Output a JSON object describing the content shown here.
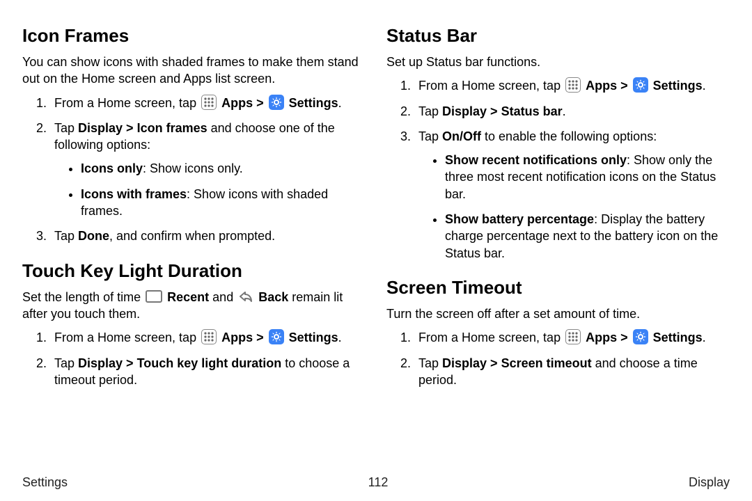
{
  "footer": {
    "left": "Settings",
    "page": "112",
    "right": "Display"
  },
  "common": {
    "home_prefix": "From a Home screen, tap ",
    "apps": "Apps",
    "settings": "Settings",
    "chev": " > ",
    "period": "."
  },
  "icon_frames": {
    "heading": "Icon Frames",
    "lead": "You can show icons with shaded frames to make them stand out on the Home screen and Apps list screen.",
    "step2a": "Tap ",
    "step2b": "Display > Icon frames",
    "step2c": " and choose one of the following options:",
    "opt1a": "Icons only",
    "opt1b": ": Show icons only.",
    "opt2a": "Icons with frames",
    "opt2b": ": Show icons with shaded frames.",
    "step3a": "Tap ",
    "step3b": "Done",
    "step3c": ", and confirm when prompted."
  },
  "touch_key": {
    "heading": "Touch Key Light Duration",
    "lead1": "Set the length of time ",
    "recent": "Recent",
    "and": " and ",
    "back": "Back",
    "lead2": " remain lit after you touch them.",
    "step2a": "Tap ",
    "step2b": "Display > Touch key light duration",
    "step2c": " to choose a timeout period."
  },
  "status_bar": {
    "heading": "Status Bar",
    "lead": "Set up Status bar functions.",
    "step2a": "Tap ",
    "step2b": "Display > Status bar",
    "step2c": ".",
    "step3a": "Tap ",
    "step3b": "On/Off",
    "step3c": " to enable the following options:",
    "opt1a": "Show recent notifications only",
    "opt1b": ": Show only the three most recent notification icons on the Status bar.",
    "opt2a": "Show battery percentage",
    "opt2b": ": Display the battery charge percentage next to the battery icon on the Status bar."
  },
  "screen_timeout": {
    "heading": "Screen Timeout",
    "lead": "Turn the screen off after a set amount of time.",
    "step2a": "Tap ",
    "step2b": "Display > Screen timeout",
    "step2c": " and choose a time period."
  }
}
